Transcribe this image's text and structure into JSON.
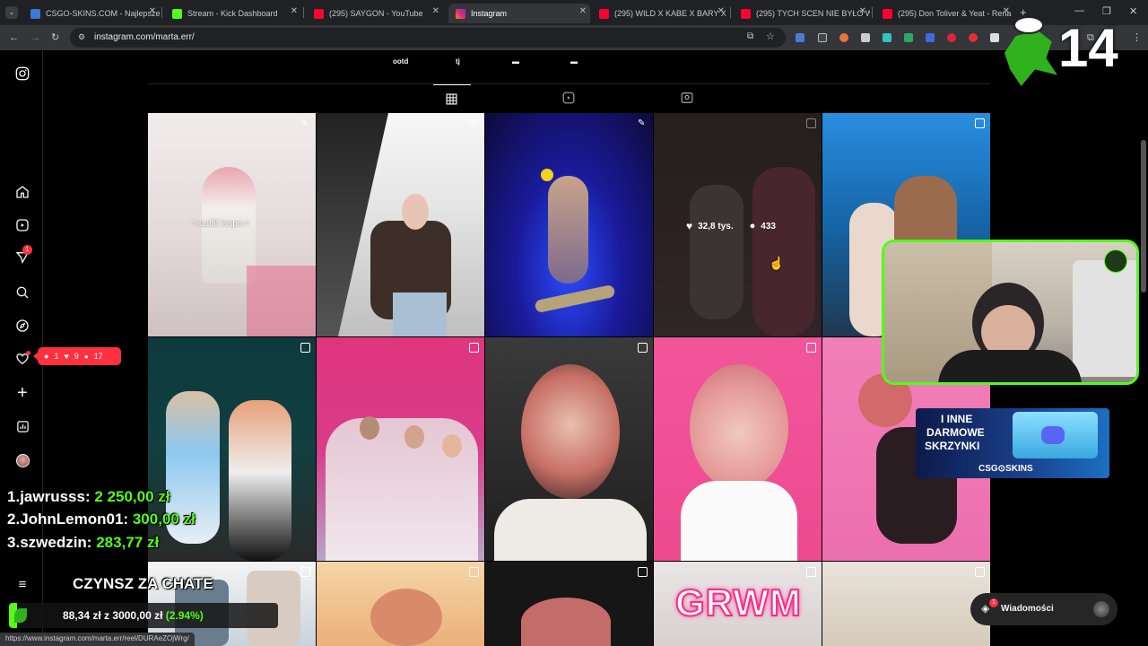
{
  "browser": {
    "tabs": [
      {
        "label": "CSGO-SKINS.COM - Najlepsze",
        "active": false,
        "favicon_color": "#3b7bd8"
      },
      {
        "label": "Stream - Kick Dashboard",
        "active": false,
        "favicon_color": "#53fc18"
      },
      {
        "label": "(295) SAYGON - YouTube",
        "active": false,
        "favicon_color": "#ff0033"
      },
      {
        "label": "Instagram",
        "active": true,
        "favicon_color": "#e1306c"
      },
      {
        "label": "(295) WILD X KABE X BARY X V",
        "active": false,
        "favicon_color": "#ff0033"
      },
      {
        "label": "(295) TYCH SCEN NIE BYŁO W",
        "active": false,
        "favicon_color": "#ff0033"
      },
      {
        "label": "(295) Don Toliver & Yeat - Rena",
        "active": false,
        "favicon_color": "#ff0033"
      }
    ],
    "url": "instagram.com/marta.err/",
    "status_url": "https://www.instagram.com/marta.err/reel/DURAeZOjWrg/"
  },
  "profile": {
    "highlights": [
      "ootd",
      "tj",
      "▬",
      "▬"
    ],
    "grid": [
      {
        "overlay_text": "☆outfit inspo☆",
        "badge": "pin"
      },
      {
        "overlay_text": "",
        "badge": "pin"
      },
      {
        "overlay_text": "",
        "badge": "pin"
      },
      {
        "overlay_text": "",
        "badge": "reel",
        "likes": "32,8 tys.",
        "comments": "433"
      },
      {
        "overlay_text": "",
        "badge": "carousel"
      },
      {
        "overlay_text": "",
        "badge": "carousel"
      },
      {
        "overlay_text": "",
        "badge": "carousel"
      },
      {
        "overlay_text": "",
        "badge": "carousel"
      },
      {
        "overlay_text": "",
        "badge": "carousel"
      },
      {
        "overlay_text": "",
        "badge": "carousel"
      },
      {
        "overlay_text": "",
        "badge": "reel"
      },
      {
        "overlay_text": "",
        "badge": "carousel"
      },
      {
        "overlay_text": "",
        "badge": "carousel"
      },
      {
        "overlay_text": "GRWM",
        "badge": "reel"
      },
      {
        "overlay_text": "",
        "badge": "carousel"
      }
    ]
  },
  "notifications": {
    "comments": "1",
    "likes": "9",
    "follows": "17",
    "messages_badge": "1"
  },
  "messages_label": "Wiadomości",
  "stream": {
    "leaderboard": [
      {
        "rank": "1.",
        "name": "jawrusss:",
        "amount": "2 250,00 zł"
      },
      {
        "rank": "2.",
        "name": "JohnLemon01:",
        "amount": "300,00 zł"
      },
      {
        "rank": "3.",
        "name": "szwedzin:",
        "amount": "283,77 zł"
      }
    ],
    "goal_title": "CZYNSZ ZA CHATE",
    "goal_current": "88,34 zł",
    "goal_sep": "z",
    "goal_target": "3000,00 zł",
    "goal_percent": "(2.94%)",
    "counter": "14",
    "promo_lines": [
      "I INNE",
      "DARMOWE",
      "SKRZYNKI"
    ],
    "promo_brand": "CSG⊙SKINS"
  },
  "colors": {
    "instagram_red": "#ff3040",
    "kick_green": "#53fc18",
    "chrome_dark": "#202124",
    "chrome_mid": "#35363a"
  }
}
